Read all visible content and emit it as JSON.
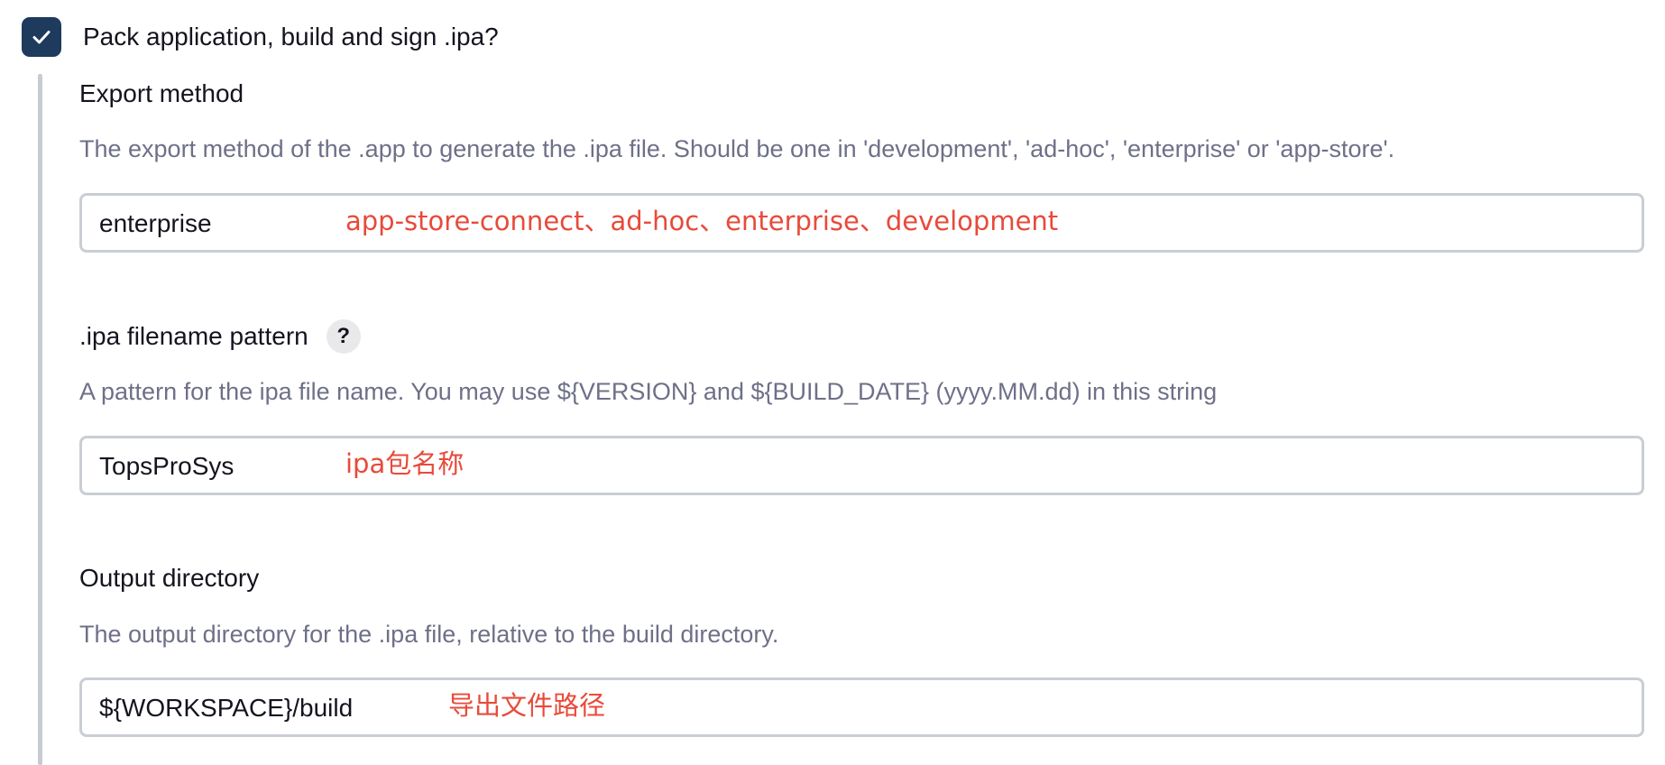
{
  "pack_checkbox": {
    "checked": true,
    "label": "Pack application, build and sign .ipa?"
  },
  "export_method": {
    "label": "Export method",
    "description": "The export method of the .app to generate the .ipa file. Should be one in 'development', 'ad-hoc', 'enterprise' or 'app-store'.",
    "value": "enterprise",
    "annotation": "app-store-connect、ad-hoc、enterprise、development"
  },
  "ipa_filename_pattern": {
    "label": ".ipa filename pattern",
    "help_icon": "?",
    "description": "A pattern for the ipa file name. You may use ${VERSION} and ${BUILD_DATE} (yyyy.MM.dd) in this string",
    "value": "TopsProSys",
    "annotation": "ipa包名称"
  },
  "output_directory": {
    "label": "Output directory",
    "description": "The output directory for the .ipa file, relative to the build directory.",
    "value": "${WORKSPACE}/build",
    "annotation": "导出文件路径"
  },
  "colors": {
    "checkbox_fill": "#1e3a5c",
    "annotation_red": "#e84a3a",
    "description_gray": "#6e7088",
    "field_border": "#c9ced4"
  },
  "icons": {
    "checkbox": "checkmark-icon",
    "help": "help-icon"
  }
}
